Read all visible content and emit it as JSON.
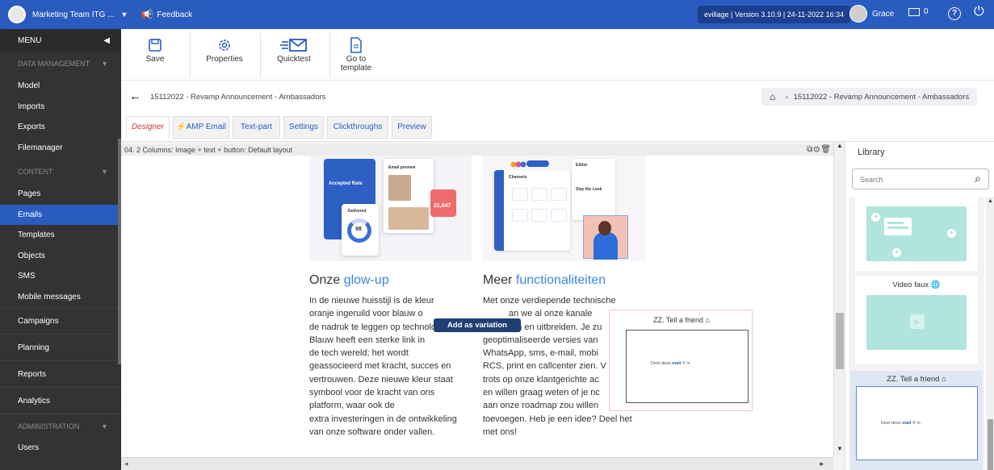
{
  "topbar": {
    "org_name": "Marketing Team ITG ...",
    "feedback_label": "Feedback",
    "version": "evillage | Version 3.10.9 | 24-11-2022 16:34",
    "user_name": "Grace",
    "mail_count": "0",
    "help_label": "?"
  },
  "sidebar": {
    "menu_label": "MENU",
    "sections": {
      "data_management": "DATA MANAGEMENT",
      "content": "CONTENT",
      "administration": "ADMINISTRATION"
    },
    "data_items": [
      "Model",
      "Imports",
      "Exports",
      "Filemanager"
    ],
    "content_items": [
      "Pages",
      "Emails",
      "Templates",
      "Objects",
      "SMS",
      "Mobile messages"
    ],
    "main_items": [
      "Campaigns",
      "Planning",
      "Reports",
      "Analytics"
    ],
    "admin_items": [
      "Users"
    ],
    "active_item": "Emails"
  },
  "toolbar": {
    "save": "Save",
    "properties": "Properties",
    "quicktest": "Quicktest",
    "goto_line1": "Go to",
    "goto_line2": "template"
  },
  "breadcrumb": {
    "title": "15112022 - Revamp Announcement - Ambassadors",
    "path_item": "15112022 - Revamp Announcement - Ambassadors"
  },
  "tabs": [
    "Designer",
    "AMP Email",
    "Text-part",
    "Settings",
    "Clickthroughs",
    "Preview"
  ],
  "active_tab": "Designer",
  "editor": {
    "block_label": "04. 2 Columns: Image + text + button: Default layout",
    "col1_title_plain": "Onze ",
    "col1_title_accent": "glow-up",
    "col1_lines": [
      "In de nieuwe huisstijl is de kleur",
      "oranje ingeruild voor blauw o",
      "de nadruk te leggen op technologie.",
      "Blauw heeft een sterke link in",
      "de tech wereld; het wordt",
      "geassocieerd met kracht, succes en",
      "vertrouwen. Deze nieuwe kleur staat",
      "symbool voor de kracht van ons",
      "platform, waar ook de",
      "extra investeringen in de ontwikkeling",
      "van onze software onder vallen."
    ],
    "col2_title_plain": "Meer ",
    "col2_title_accent": "functionaliteiten",
    "col2_lines": [
      "Met onze verdiepende technische",
      "an we al onze kanale",
      "innoveren en uitbreiden. Je zu",
      "geoptimaliseerde versies van",
      "WhatsApp, sms, e-mail, mobi",
      "RCS, print en callcenter zien. V",
      "trots op onze klantgerichte ac",
      "en willen graag weten of je nc",
      "aan onze roadmap zou willen",
      "toevoegen. Heb je een idee? Deel het",
      "met ons!"
    ],
    "add_variation": "Add as variation",
    "drop_title": "ZZ. Tell a friend",
    "share_prefix": "Deel deze ",
    "share_link": "mail",
    "share_icons": "© in",
    "img1": {
      "accepted_rate": "Accepted Rate",
      "delivered": "Delivered",
      "ring_value": "98",
      "email_preview": "Email preview",
      "red_value": "21,647"
    },
    "img2": {
      "channels": "Channels",
      "editor": "Editor",
      "slay": "Slay the Look"
    }
  },
  "library": {
    "title": "Library",
    "search_placeholder": "Search",
    "video_label": "Video faux",
    "friend_label": "ZZ. Tell a friend"
  }
}
